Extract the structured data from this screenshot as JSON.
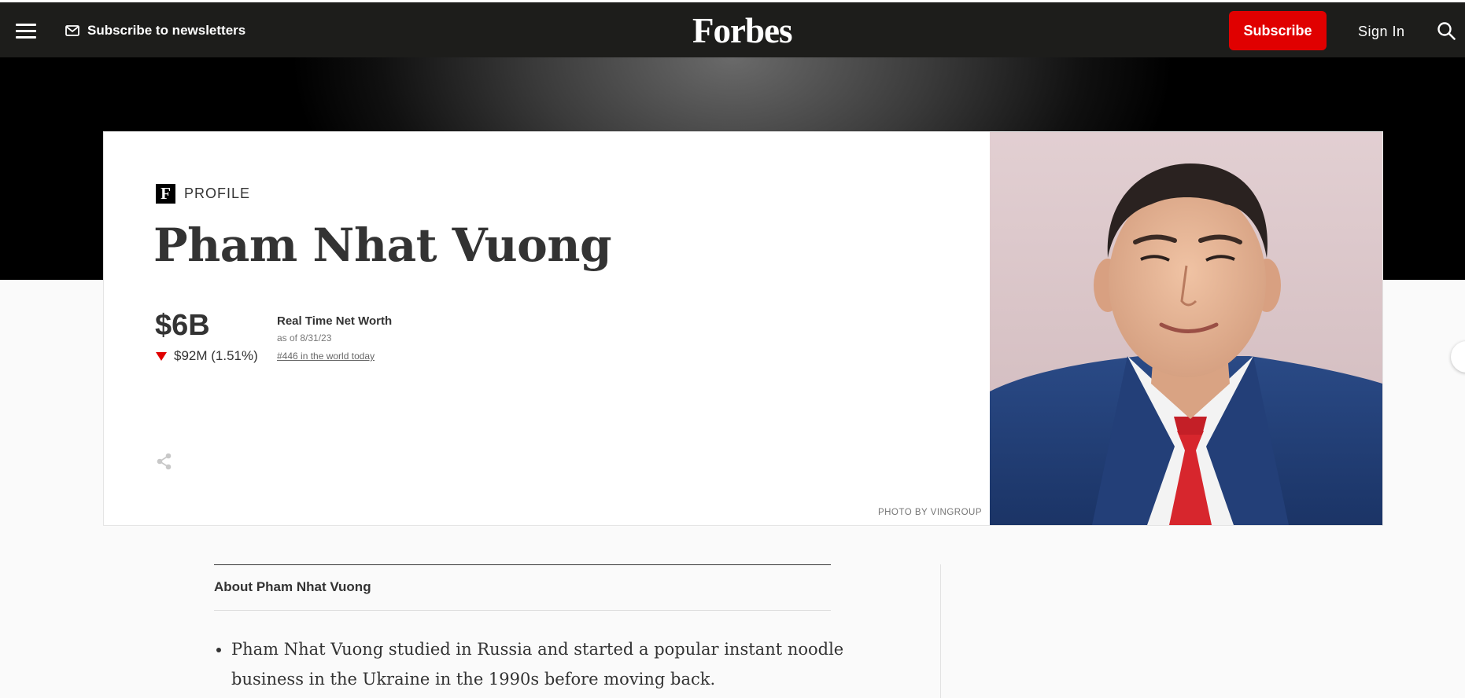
{
  "topbar": {
    "menu_icon": "hamburger-menu-icon",
    "newsletter_icon": "mail-icon",
    "newsletter_label": "Subscribe to newsletters",
    "logo_text": "Forbes",
    "subscribe_label": "Subscribe",
    "signin_label": "Sign In",
    "search_icon": "search-icon"
  },
  "profile": {
    "badge_letter": "F",
    "label": "PROFILE",
    "name": "Pham Nhat Vuong",
    "net_worth": "$6B",
    "change_direction": "down",
    "change": "$92M (1.51%)",
    "realtime_title": "Real Time Net Worth",
    "as_of": "as of 8/31/23",
    "rank": "#446 in the world today",
    "share_icon": "share-icon",
    "photo_credit": "PHOTO BY VINGROUP"
  },
  "about": {
    "title": "About Pham Nhat Vuong",
    "bullets": [
      "Pham Nhat Vuong studied in Russia and started a popular instant noodle business in the Ukraine in the 1990s before moving back."
    ]
  },
  "colors": {
    "nav_background": "#1d1d1b",
    "subscribe_red": "#e00000",
    "text_dark": "#333333"
  }
}
